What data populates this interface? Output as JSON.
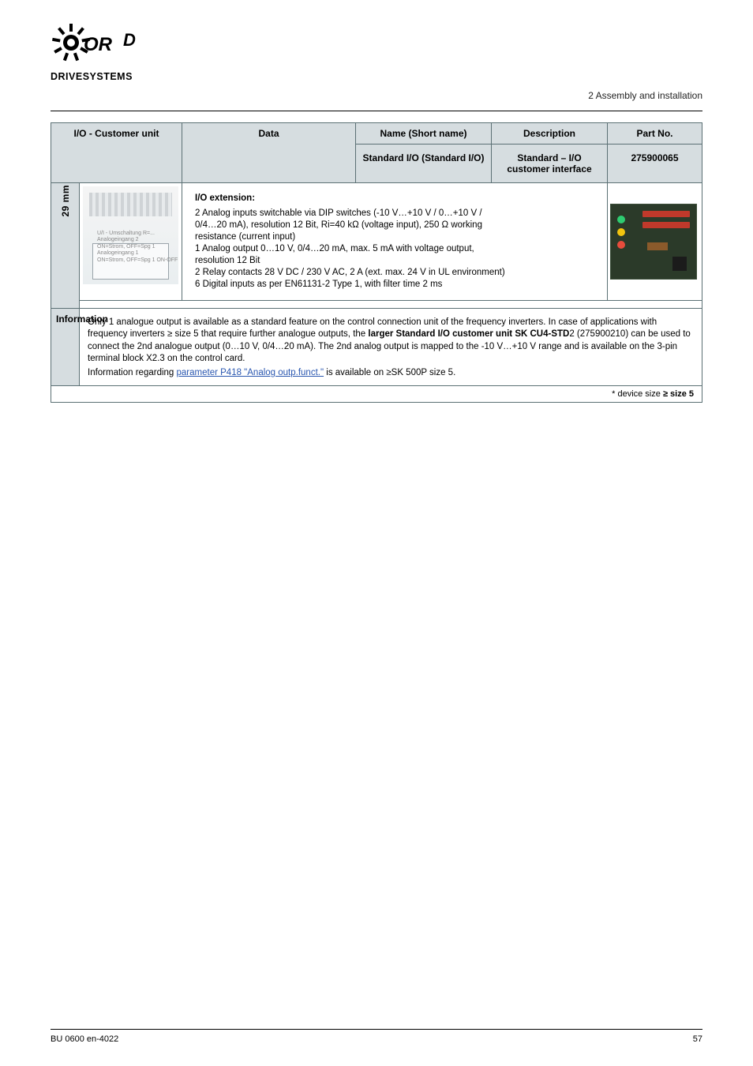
{
  "brand": {
    "line1": "NORD",
    "line2": "DRIVESYSTEMS"
  },
  "header_right": "2 Assembly and installation",
  "columns": {
    "group": "I/O - Customer unit",
    "data": "Data",
    "name_short": "Name (Short name)",
    "desc": "Description",
    "part_no": "Part No."
  },
  "subheaders": {
    "name_val": "Standard I/O (Standard I/O)",
    "desc_val": "Standard – I/O customer interface",
    "part_val": "275900065"
  },
  "imgrow": {
    "term_lines": [
      "",
      ""
    ],
    "ext_title": "I/O extension:",
    "bullets": [
      "2 Analog inputs switchable via DIP switches (-10 V…+10 V / 0…+10 V / 0/4…20 mA), resolution 12 Bit, Ri=40 kΩ (voltage input), 250 Ω working resistance (current input)",
      "1 Analog output 0…10 V, 0/4…20 mA, max. 5 mA with voltage output, resolution 12 Bit",
      "2 Relay contacts 28 V DC / 230 V AC, 2 A (ext. max. 24 V in UL environment)",
      "6 Digital inputs as per EN61131-2 Type 1, with filter time 2 ms"
    ]
  },
  "maxh": {
    "value": "29 mm"
  },
  "info": {
    "label": "Information",
    "p1_a": "Only 1 analogue output is available as a standard feature on the control connection unit of the frequency inverters. In case of applications with frequency inverters ",
    "p1_b": "≥ size 5",
    "p1_c": " that require further analogue outputs, the ",
    "p1_d": "larger Standard I/O customer unit SK CU4-STD",
    "p1_e": "2 (275900210) can be used to connect the 2nd analogue output (0…10 V, 0/4…20 mA). The 2nd analog output is mapped to the -10 V…+10 V range and is available on the 3-pin terminal block X2.3 on the control card.",
    "p2_a": "Information regarding ",
    "p2_link": "parameter P418 \"Analog outp.funct.\"",
    "p2_b": " is available on ≥SK 500P size 5.",
    "star": "*",
    "size_text": "device size",
    "size_strong": "≥ size 5"
  },
  "footer": {
    "left": "BU 0600 en-4022",
    "right": "57"
  },
  "icons": {
    "term_labels": "U/I - Umschaltung  R=...\nAnalogeingang 2\nON=Strom, OFF=Spg 1\nAnalogeingang 1\nON=Strom, OFF=Spg 1  ON-OFF"
  }
}
